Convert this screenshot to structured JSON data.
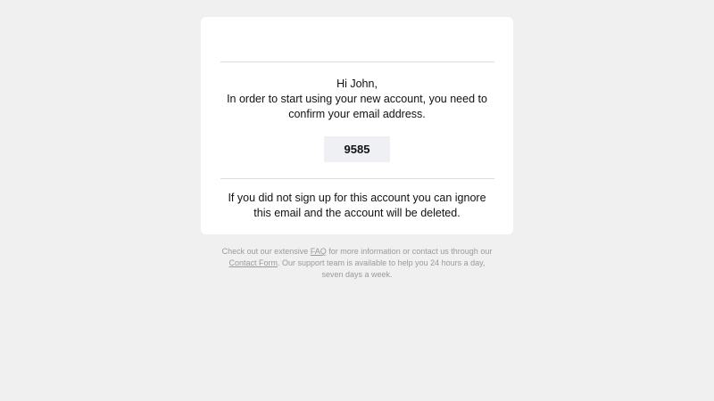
{
  "email": {
    "greeting": "Hi John,",
    "message": "In order to start using your new account, you need to confirm your email address.",
    "code": "9585",
    "ignore_note": "If you did not sign up for this account you can ignore this email and the account will be deleted."
  },
  "footer": {
    "text_before_faq": "Check out our extensive ",
    "faq_link": "FAQ",
    "text_between": " for more information or contact us through our ",
    "contact_link": "Contact Form",
    "text_after": ". Our support team is available to help you 24 hours a day, seven days a week."
  },
  "colors": {
    "page_background": "#f0f0f0",
    "card_background": "#ffffff",
    "code_background": "#eef0f4",
    "footer_text": "#9a9a9a"
  }
}
